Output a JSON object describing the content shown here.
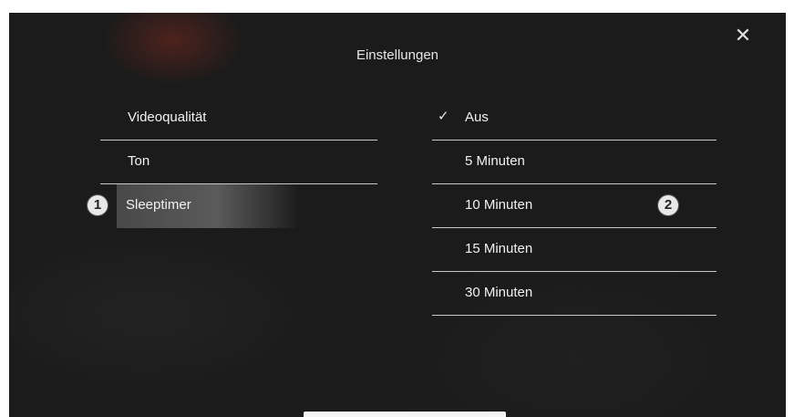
{
  "dialog": {
    "title": "Einstellungen",
    "close_icon": "close-icon"
  },
  "categories": [
    {
      "label": "Videoqualität"
    },
    {
      "label": "Ton"
    },
    {
      "label": "Sleeptimer",
      "selected": true,
      "badge": "1"
    }
  ],
  "options": [
    {
      "label": "Aus",
      "checked": true
    },
    {
      "label": "5 Minuten"
    },
    {
      "label": "10 Minuten",
      "badge": "2"
    },
    {
      "label": "15 Minuten"
    },
    {
      "label": "30 Minuten"
    }
  ],
  "callouts": {
    "left": "1",
    "right": "2"
  }
}
